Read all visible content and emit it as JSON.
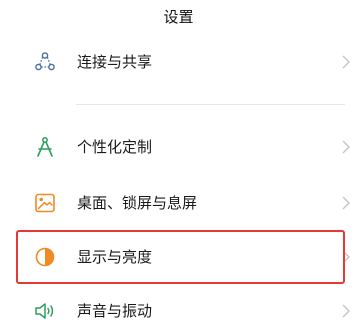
{
  "header": {
    "title": "设置"
  },
  "settings_items": [
    {
      "label": "连接与共享",
      "icon": "connection-share-icon"
    },
    {
      "label": "个性化定制",
      "icon": "personalization-icon"
    },
    {
      "label": "桌面、锁屏与息屏",
      "icon": "wallpaper-icon"
    },
    {
      "label": "显示与亮度",
      "icon": "display-brightness-icon"
    },
    {
      "label": "声音与振动",
      "icon": "sound-vibration-icon"
    }
  ],
  "highlight": {
    "color": "#e53935",
    "item": "显示与亮度"
  },
  "colors": {
    "icon_green": "#2e9e5e",
    "icon_orange": "#f08a24",
    "icon_connection": "#4a6fa5"
  }
}
